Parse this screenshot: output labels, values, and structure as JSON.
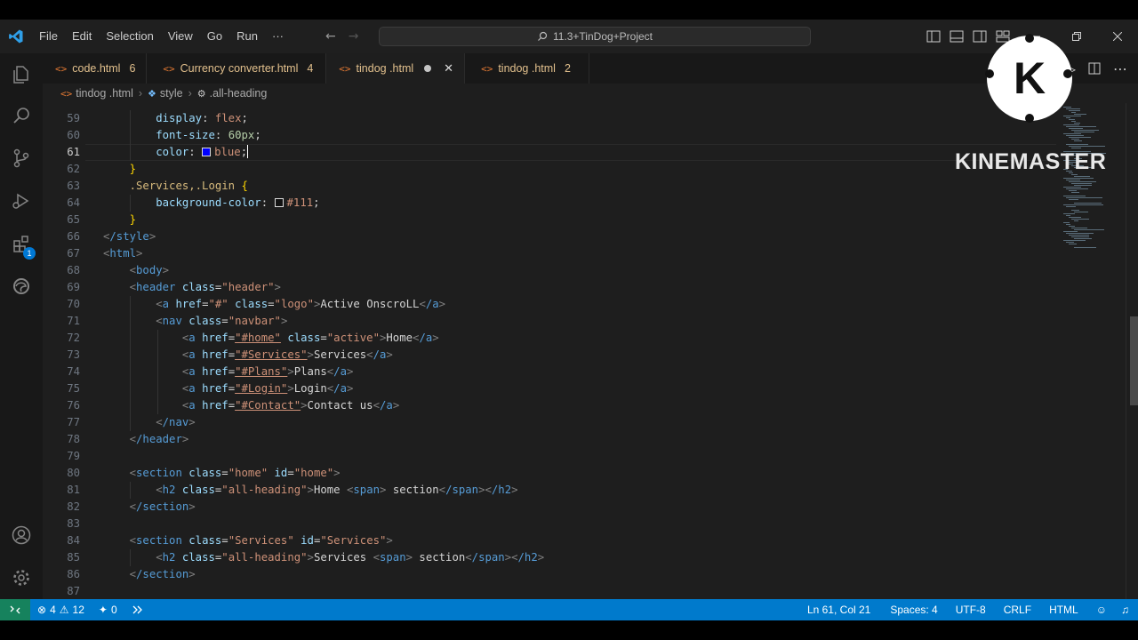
{
  "menu": {
    "items": [
      "File",
      "Edit",
      "Selection",
      "View",
      "Go",
      "Run",
      "···"
    ]
  },
  "command_center": {
    "label": "11.3+TinDog+Project"
  },
  "tabs": [
    {
      "label": "code.html",
      "count": "6",
      "active": false
    },
    {
      "label": "Currency converter.html",
      "count": "4",
      "active": false
    },
    {
      "label": "tindog .html",
      "count": "",
      "active": true
    },
    {
      "label": "tindog .html",
      "count": "2",
      "active": false
    }
  ],
  "breadcrumb": {
    "file": "tindog .html",
    "element": "style",
    "selector": ".all-heading"
  },
  "editor": {
    "current_line": 61,
    "lines": [
      {
        "n": 59,
        "code": "        display: flex;"
      },
      {
        "n": 60,
        "code": "        font-size: 60px;"
      },
      {
        "n": 61,
        "code": "        color: blue;"
      },
      {
        "n": 62,
        "code": "    }"
      },
      {
        "n": 63,
        "code": "    .Services,.Login {"
      },
      {
        "n": 64,
        "code": "        background-color: #111;"
      },
      {
        "n": 65,
        "code": "    }"
      },
      {
        "n": 66,
        "code": "</style>"
      },
      {
        "n": 67,
        "code": "<html>"
      },
      {
        "n": 68,
        "code": "    <body>"
      },
      {
        "n": 69,
        "code": "    <header class=\"header\">"
      },
      {
        "n": 70,
        "code": "        <a href=\"#\" class=\"logo\">Active OnscroLL</a>"
      },
      {
        "n": 71,
        "code": "        <nav class=\"navbar\">"
      },
      {
        "n": 72,
        "code": "            <a href=\"#home\" class=\"active\">Home</a>"
      },
      {
        "n": 73,
        "code": "            <a href=\"#Services\">Services</a>"
      },
      {
        "n": 74,
        "code": "            <a href=\"#Plans\">Plans</a>"
      },
      {
        "n": 75,
        "code": "            <a href=\"#Login\">Login</a>"
      },
      {
        "n": 76,
        "code": "            <a href=\"#Contact\">Contact us</a>"
      },
      {
        "n": 77,
        "code": "        </nav>"
      },
      {
        "n": 78,
        "code": "    </header>"
      },
      {
        "n": 79,
        "code": ""
      },
      {
        "n": 80,
        "code": "    <section class=\"home\" id=\"home\">"
      },
      {
        "n": 81,
        "code": "        <h2 class=\"all-heading\">Home <span> section</span></h2>"
      },
      {
        "n": 82,
        "code": "    </section>"
      },
      {
        "n": 83,
        "code": ""
      },
      {
        "n": 84,
        "code": "    <section class=\"Services\" id=\"Services\">"
      },
      {
        "n": 85,
        "code": "        <h2 class=\"all-heading\">Services <span> section</span></h2>"
      },
      {
        "n": 86,
        "code": "    </section>"
      },
      {
        "n": 87,
        "code": ""
      }
    ]
  },
  "watermark": {
    "text": "KINEMASTER",
    "letter": "K"
  },
  "activity_badge": "1",
  "status": {
    "errors": "4",
    "warnings": "12",
    "ports": "0",
    "cursor": "Ln 61, Col 21",
    "spaces": "Spaces: 4",
    "encoding": "UTF-8",
    "eol": "CRLF",
    "language": "HTML"
  },
  "colors": {
    "accent": "#007acc",
    "editor_bg": "#1e1e1e",
    "tag": "#569cd6",
    "attribute": "#9cdcfe",
    "string": "#ce9178",
    "selector": "#d7ba7d",
    "modified_tab": "#e2c08d"
  }
}
